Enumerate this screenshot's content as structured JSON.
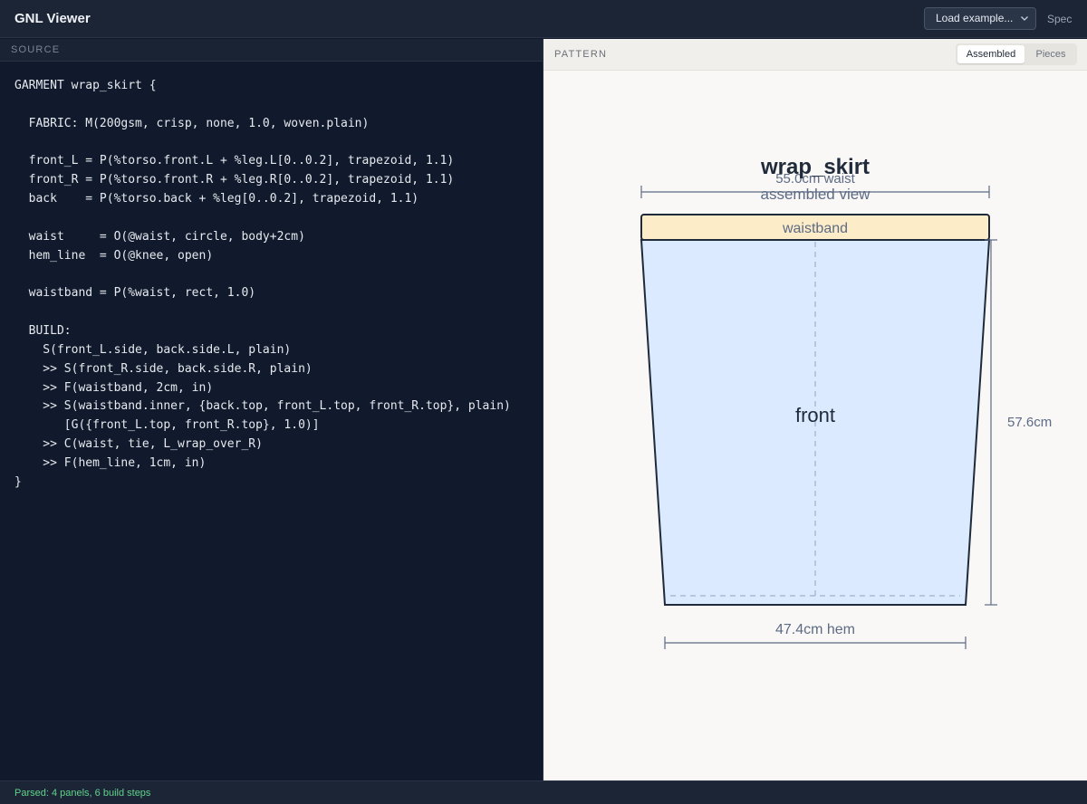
{
  "app": {
    "title": "GNL Viewer"
  },
  "toolbar": {
    "example_select": "Load example...",
    "spec_link": "Spec"
  },
  "source": {
    "header": "SOURCE",
    "code": "GARMENT wrap_skirt {\n\n  FABRIC: M(200gsm, crisp, none, 1.0, woven.plain)\n\n  front_L = P(%torso.front.L + %leg.L[0..0.2], trapezoid, 1.1)\n  front_R = P(%torso.front.R + %leg.R[0..0.2], trapezoid, 1.1)\n  back    = P(%torso.back + %leg[0..0.2], trapezoid, 1.1)\n\n  waist     = O(@waist, circle, body+2cm)\n  hem_line  = O(@knee, open)\n\n  waistband = P(%waist, rect, 1.0)\n\n  BUILD:\n    S(front_L.side, back.side.L, plain)\n    >> S(front_R.side, back.side.R, plain)\n    >> F(waistband, 2cm, in)\n    >> S(waistband.inner, {back.top, front_L.top, front_R.top}, plain)\n       [G({front_L.top, front_R.top}, 1.0)]\n    >> C(waist, tie, L_wrap_over_R)\n    >> F(hem_line, 1cm, in)\n}"
  },
  "pattern": {
    "header": "PATTERN",
    "view_modes": {
      "assembled": "Assembled",
      "pieces": "Pieces",
      "active": "Assembled"
    },
    "title": "wrap_skirt",
    "subtitle": "assembled view",
    "waist_label": "55.0cm waist",
    "waistband_label": "waistband",
    "panel_label": "front",
    "height_label": "57.6cm",
    "hem_label": "47.4cm hem",
    "colors": {
      "waistband_fill": "#fdecc8",
      "panel_fill": "#dbeafe",
      "outline": "#1f2a3a",
      "dimension": "#5d6b85"
    }
  },
  "status": {
    "text": "Parsed: 4 panels, 6 build steps",
    "color": "#5fd38a"
  }
}
